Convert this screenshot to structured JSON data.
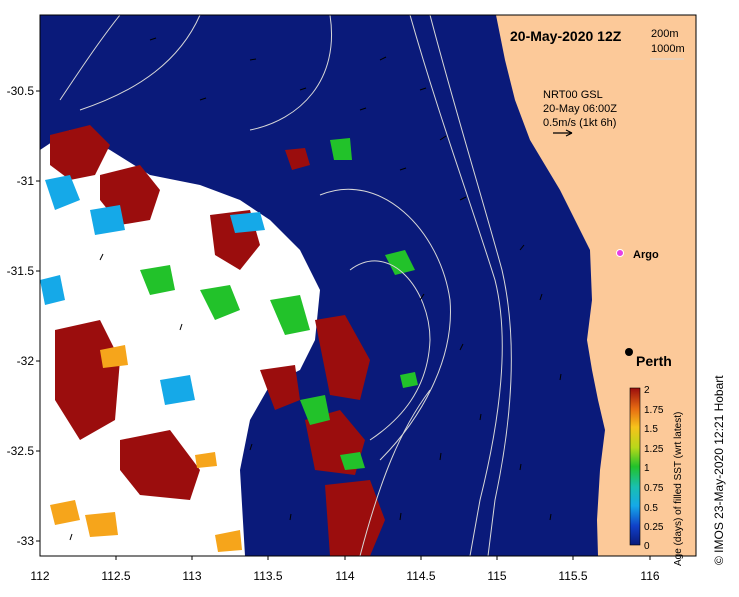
{
  "map": {
    "title": "20-May-2020 12Z",
    "contour_legend": [
      "200m",
      "1000m"
    ],
    "product_info": [
      "NRT00 GSL",
      "20-May 06:00Z",
      "0.5m/s (1kt 6h)"
    ],
    "labels": {
      "argo": "Argo",
      "city": "Perth",
      "credit": "©  IMOS 23-May-2020 12:21 Hobart"
    },
    "axes": {
      "x_ticks": [
        "112",
        "112.5",
        "113",
        "113.5",
        "114",
        "114.5",
        "115",
        "115.5",
        "116"
      ],
      "y_ticks": [
        "-30.5",
        "-31",
        "-31.5",
        "-32",
        "-32.5",
        "-33"
      ]
    },
    "colorbar": {
      "label": "Age (days) of filled SST (wrt latest)",
      "ticks": [
        "2",
        "1.75",
        "1.5",
        "1.25",
        "1",
        "0.75",
        "0.5",
        "0.25",
        "0"
      ]
    },
    "colors": {
      "ocean": "#0a1a7a",
      "land": "#fcc999",
      "no_data": "#ffffff",
      "age_dark_red": "#9b0d0d",
      "age_green": "#22c22a",
      "age_cyan": "#15a9e8",
      "age_orange": "#f6a51b",
      "argo_marker": "#e63ee6"
    }
  }
}
